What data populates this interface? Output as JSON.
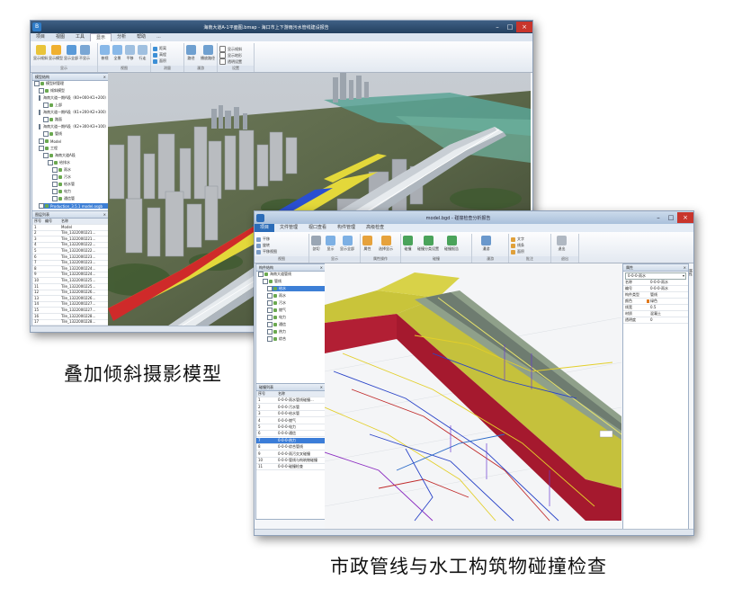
{
  "caption_top": "叠加倾斜摄影模型",
  "caption_bottom": "市政管线与水工构筑物碰撞检查",
  "window1": {
    "app_badge": "B",
    "title": "海南大道A-1平面图.bmap - 海口市上下游雨污水管线建设报告",
    "menu": [
      "项目",
      "视图",
      "工具",
      "显示",
      "分析",
      "帮助",
      "..."
    ],
    "active_menu_index": 3,
    "ribbon_groups": [
      {
        "label": "显示",
        "buttons": [
          "显示倾斜",
          "显示模型",
          "显示全部",
          "不显示"
        ]
      },
      {
        "label": "视图",
        "buttons": [
          "俯视",
          "全景",
          "平移",
          "行走"
        ]
      },
      {
        "label": "测量",
        "small": [
          "距离",
          "高程",
          "面积"
        ]
      },
      {
        "label": "漫游",
        "buttons": [
          "路径",
          "播放路径"
        ]
      },
      {
        "label": "设置",
        "small": [
          "显示倾斜",
          "显示地形",
          "透明设置"
        ]
      }
    ],
    "tree_panel_title": "模型结构",
    "tree_items": [
      "模型树管理",
      "倾斜模型",
      "海南大道—期A段（K0+000-K1+200）工程",
      "上部",
      "海南大道—期A段（K1+200-K2+300）工程",
      "路面",
      "海南大道—期A段（K2+300-K3+100）工程",
      "管线",
      "Model",
      "工程",
      "海南大道A段",
      "给排水",
      "雨水",
      "污水",
      "给水管",
      "电力",
      "通信管",
      "Production_3.5.1 model.osgb"
    ],
    "selected_tree_index": 17,
    "list_panel_title": "图层列表",
    "list_headers": [
      "序号",
      "编号",
      "名称"
    ],
    "list_rows": [
      [
        "1",
        "",
        "Model"
      ],
      [
        "2",
        "",
        "Tile_1322000221..."
      ],
      [
        "3",
        "",
        "Tile_1322000221..."
      ],
      [
        "4",
        "",
        "Tile_1322000222..."
      ],
      [
        "5",
        "",
        "Tile_1322000222..."
      ],
      [
        "6",
        "",
        "Tile_1322000223..."
      ],
      [
        "7",
        "",
        "Tile_1322000223..."
      ],
      [
        "8",
        "",
        "Tile_1322000224..."
      ],
      [
        "9",
        "",
        "Tile_1322000224..."
      ],
      [
        "10",
        "",
        "Tile_1322000225..."
      ],
      [
        "11",
        "",
        "Tile_1322000225..."
      ],
      [
        "12",
        "",
        "Tile_1322000226..."
      ],
      [
        "13",
        "",
        "Tile_1322000226..."
      ],
      [
        "14",
        "",
        "Tile_1322000227..."
      ],
      [
        "15",
        "",
        "Tile_1322000227..."
      ],
      [
        "16",
        "",
        "Tile_1322000228..."
      ],
      [
        "17",
        "",
        "Tile_1322000228..."
      ]
    ]
  },
  "window2": {
    "title": "model.bgd - 碰撞检查分析报告",
    "menu": [
      "项目",
      "文件管理",
      "视口查看",
      "构件管理",
      "高级检查"
    ],
    "ribbon_groups": [
      {
        "label": "视图",
        "small": [
          "平移",
          "旋转",
          "平移视图"
        ]
      },
      {
        "label": "显示",
        "buttons": [
          "剖切",
          "显示",
          "显示全部"
        ]
      },
      {
        "label": "属性操作",
        "buttons": [
          "属性",
          "选择显示"
        ]
      },
      {
        "label": "碰撞",
        "buttons": [
          "碰撞",
          "碰撞分类设置",
          "碰撞报告"
        ]
      },
      {
        "label": "漫游",
        "buttons": [
          "漫游"
        ]
      },
      {
        "label": "批注",
        "small": [
          "文字",
          "线条",
          "面积"
        ]
      },
      {
        "label": "退出",
        "buttons": [
          "退出"
        ]
      }
    ],
    "tree_panel_title": "构件结构",
    "tree_items": [
      "海南大道管线",
      "管线",
      "给水",
      "雨水",
      "污水",
      "燃气",
      "电力",
      "通信",
      "热力",
      "综合"
    ],
    "selected_tree_index": 2,
    "list_panel_title": "碰撞列表",
    "list_headers": [
      "序号",
      "名称"
    ],
    "list_rows": [
      [
        "1",
        "0-0-0-雨水管线碰撞..."
      ],
      [
        "2",
        "0-0-0-污水管"
      ],
      [
        "3",
        "0-0-0-给水管"
      ],
      [
        "4",
        "0-0-0-燃气"
      ],
      [
        "5",
        "0-0-0-电力"
      ],
      [
        "6",
        "0-0-0-通信"
      ],
      [
        "7",
        "0-0-0-热力"
      ],
      [
        "8",
        "0-0-0-综合管线"
      ],
      [
        "9",
        "0-0-0-雨污交叉碰撞"
      ],
      [
        "10",
        "0-0-0-管线与构筑物碰撞"
      ],
      [
        "11",
        "0-0-0-碰撞检查"
      ]
    ],
    "selected_list_index": 6,
    "props_title": "属性",
    "props_dropdown": "0-0-0-雨水",
    "props_rows": [
      [
        "名称",
        "0-0-0-雨水"
      ],
      [
        "编号",
        "0-0-0-雨水"
      ],
      [
        "构件类型",
        "管线"
      ],
      [
        "颜色",
        "绿色"
      ],
      [
        "线宽",
        "0.5"
      ],
      [
        "材质",
        "混凝土"
      ],
      [
        "透明度",
        "0"
      ]
    ],
    "side_tab": "属性"
  }
}
